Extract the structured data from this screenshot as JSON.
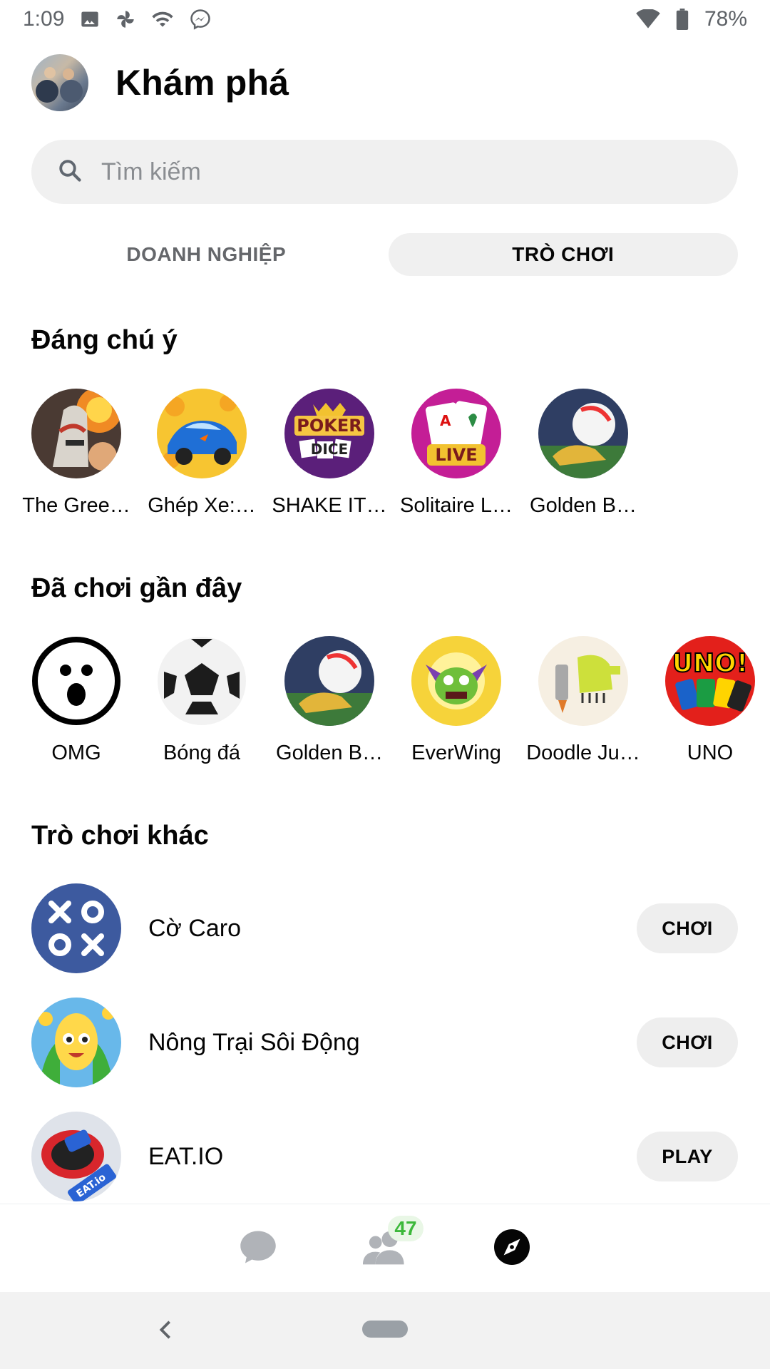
{
  "status_bar": {
    "time": "1:09",
    "battery": "78%",
    "icons": [
      "image-icon",
      "pinwheel-icon",
      "wifi-icon",
      "messenger-icon",
      "signal-icon",
      "battery-icon"
    ]
  },
  "header": {
    "title": "Khám phá",
    "avatar": "profile-avatar"
  },
  "search": {
    "placeholder": "Tìm kiếm"
  },
  "tabs": [
    {
      "label": "DOANH NGHIỆP",
      "active": false
    },
    {
      "label": "TRÒ CHƠI",
      "active": true
    }
  ],
  "sections": {
    "featured": {
      "title": "Đáng chú ý",
      "games": [
        {
          "label": "The Gree…",
          "icon": "the-green-game-icon"
        },
        {
          "label": "Ghép Xe:…",
          "icon": "ghep-xe-icon"
        },
        {
          "label": "SHAKE IT…",
          "icon": "poker-dice-icon"
        },
        {
          "label": "Solitaire L…",
          "icon": "solitaire-live-icon"
        },
        {
          "label": "Golden B…",
          "icon": "golden-boot-icon"
        }
      ]
    },
    "recent": {
      "title": "Đã chơi gần đây",
      "games": [
        {
          "label": "OMG",
          "icon": "omg-icon"
        },
        {
          "label": "Bóng đá",
          "icon": "soccer-ball-icon"
        },
        {
          "label": "Golden B…",
          "icon": "golden-boot-icon"
        },
        {
          "label": "EverWing",
          "icon": "everwing-icon"
        },
        {
          "label": "Doodle Ju…",
          "icon": "doodle-jump-icon"
        },
        {
          "label": "UNO",
          "icon": "uno-icon"
        }
      ]
    },
    "other": {
      "title": "Trò chơi khác",
      "items": [
        {
          "name": "Cờ Caro",
          "button": "CHƠI",
          "icon": "caro-icon"
        },
        {
          "name": "Nông Trại Sôi Động",
          "button": "CHƠI",
          "icon": "farm-corn-icon"
        },
        {
          "name": "EAT.IO",
          "button": "PLAY",
          "icon": "eat-io-icon"
        }
      ]
    }
  },
  "bottom_nav": {
    "people_badge": "47",
    "items": [
      "chats-icon",
      "people-icon",
      "discover-icon"
    ],
    "active": "discover-icon"
  },
  "colors": {
    "accent_badge": "#3cb83a",
    "chip_bg": "#f0f0f0",
    "text_primary": "#050505",
    "text_secondary": "#65676b"
  }
}
